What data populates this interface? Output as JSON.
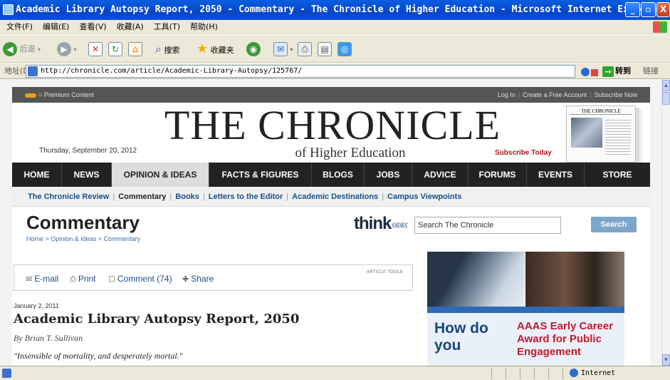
{
  "window": {
    "title": "Academic Library Autopsy Report, 2050 - Commentary - The Chronicle of Higher Education - Microsoft Internet Explorer",
    "controls": {
      "minimize": "_",
      "maximize": "▫",
      "close": "X"
    }
  },
  "menu": [
    "文件(F)",
    "编辑(E)",
    "查看(V)",
    "收藏(A)",
    "工具(T)",
    "帮助(H)"
  ],
  "toolbar": {
    "back": "后退",
    "search": "搜索",
    "favorites": "收藏夹"
  },
  "address": {
    "label": "地址(D)",
    "url": "http://chronicle.com/article/Academic-Library-Autopsy/125767/",
    "go": "转到",
    "links": "链接"
  },
  "status": {
    "zone": "Internet"
  },
  "site": {
    "premium": "= Premium Content",
    "top_links": [
      "Log In",
      "Create a Free Account",
      "Subscribe Now"
    ],
    "date": "Thursday, September 20, 2012",
    "logo": "THE CHRONICLE",
    "logo_sub": "of Higher Education",
    "subscribe": "Subscribe Today",
    "cover_title": "THE CHRONICLE",
    "nav": [
      "HOME",
      "NEWS",
      "OPINION & IDEAS",
      "FACTS & FIGURES",
      "BLOGS",
      "JOBS",
      "ADVICE",
      "FORUMS",
      "EVENTS",
      "STORE"
    ],
    "nav_active": "OPINION & IDEAS",
    "subnav": [
      "The Chronicle Review",
      "Commentary",
      "Books",
      "Letters to the Editor",
      "Academic Destinations",
      "Campus Viewpoints"
    ],
    "section_title": "Commentary",
    "breadcrumb": "Home > Opinion & Ideas > Commentary",
    "think": "think",
    "search_value": "Search The Chronicle",
    "search_button": "Search"
  },
  "article_tools": {
    "email": "E-mail",
    "print": "Print",
    "comment": "Comment (74)",
    "share": "Share",
    "label": "ARTICLE TOOLS"
  },
  "article": {
    "date": "January 2, 2011",
    "title": "Academic Library Autopsy Report, 2050",
    "byline": "By Brian T. Sullivan",
    "quote": "\"Insensible of mortality, and desperately mortal.\""
  },
  "ad": {
    "headline": "How do you",
    "award": "AAAS Early Career Award for Public Engagement"
  }
}
